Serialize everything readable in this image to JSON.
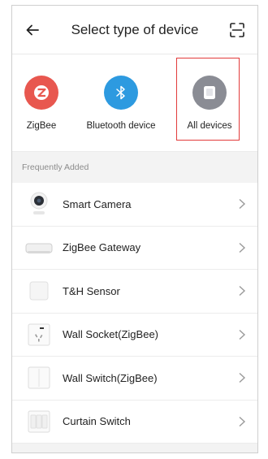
{
  "header": {
    "title": "Select type of device",
    "back_icon": "arrow-left-icon",
    "scan_icon": "scan-icon"
  },
  "device_types": [
    {
      "label": "ZigBee",
      "icon": "zigbee-icon",
      "color": "#e8574f"
    },
    {
      "label": "Bluetooth device",
      "icon": "bluetooth-icon",
      "color": "#2d9ae0"
    },
    {
      "label": "All devices",
      "icon": "all-devices-icon",
      "color": "#8a8c94",
      "selected": true
    }
  ],
  "section": {
    "title": "Frequently Added"
  },
  "devices": [
    {
      "name": "Smart Camera",
      "icon": "smart-camera-icon"
    },
    {
      "name": "ZigBee Gateway",
      "icon": "zigbee-gateway-icon"
    },
    {
      "name": "T&H Sensor",
      "icon": "th-sensor-icon"
    },
    {
      "name": "Wall Socket(ZigBee)",
      "icon": "wall-socket-icon"
    },
    {
      "name": "Wall Switch(ZigBee)",
      "icon": "wall-switch-icon"
    },
    {
      "name": "Curtain Switch",
      "icon": "curtain-switch-icon"
    }
  ],
  "colors": {
    "selection_border": "#e23b3b",
    "chevron": "#9a9a9a"
  }
}
